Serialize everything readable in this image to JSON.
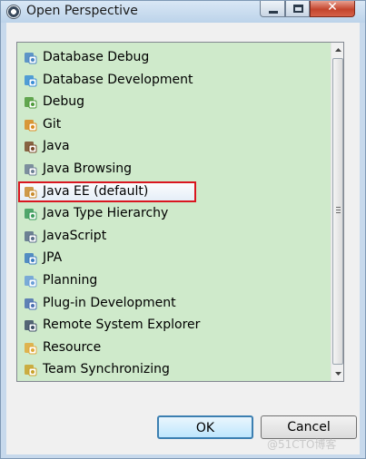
{
  "window": {
    "title": "Open Perspective",
    "close_glyph": "✕"
  },
  "perspectives": [
    {
      "label": "Database Debug",
      "icon": "database-debug-icon",
      "color": "#4a86c5"
    },
    {
      "label": "Database Development",
      "icon": "database-development-icon",
      "color": "#3b8fd6"
    },
    {
      "label": "Debug",
      "icon": "bug-icon",
      "color": "#4e9a3a"
    },
    {
      "label": "Git",
      "icon": "git-icon",
      "color": "#d98a1f"
    },
    {
      "label": "Java",
      "icon": "java-icon",
      "color": "#7a4b2a"
    },
    {
      "label": "Java Browsing",
      "icon": "java-browsing-icon",
      "color": "#6d7f95"
    },
    {
      "label": "Java EE (default)",
      "icon": "java-ee-icon",
      "color": "#c88a2c",
      "selected": true
    },
    {
      "label": "Java Type Hierarchy",
      "icon": "type-hierarchy-icon",
      "color": "#3a9a5a"
    },
    {
      "label": "JavaScript",
      "icon": "javascript-icon",
      "color": "#5b6f8a"
    },
    {
      "label": "JPA",
      "icon": "jpa-icon",
      "color": "#3d7dbf"
    },
    {
      "label": "Planning",
      "icon": "planning-icon",
      "color": "#6b9fd8"
    },
    {
      "label": "Plug-in Development",
      "icon": "plugin-icon",
      "color": "#4b6fb0"
    },
    {
      "label": "Remote System Explorer",
      "icon": "remote-system-icon",
      "color": "#3e4f66"
    },
    {
      "label": "Resource",
      "icon": "resource-icon",
      "color": "#e0a93a"
    },
    {
      "label": "Team Synchronizing",
      "icon": "team-sync-icon",
      "color": "#c9a22a"
    }
  ],
  "buttons": {
    "ok": "OK",
    "cancel": "Cancel"
  },
  "watermark": "@51CTO博客"
}
